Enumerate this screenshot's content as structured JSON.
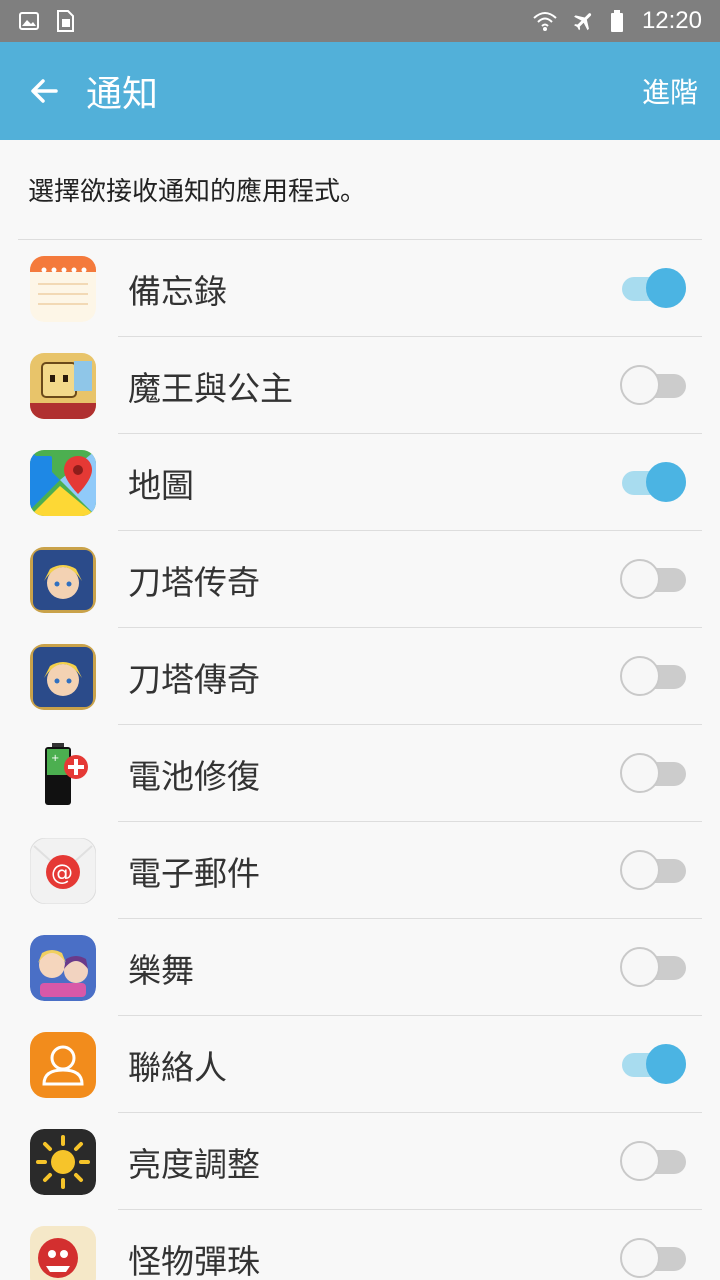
{
  "status_bar": {
    "time": "12:20",
    "icons": [
      "image-icon",
      "sim-icon",
      "wifi-icon",
      "airplane-icon",
      "battery-icon"
    ]
  },
  "app_bar": {
    "title": "通知",
    "advanced_label": "進階"
  },
  "description": "選擇欲接收通知的應用程式。",
  "apps": [
    {
      "name": "備忘錄",
      "enabled": true,
      "icon": "memo-icon"
    },
    {
      "name": "魔王與公主",
      "enabled": false,
      "icon": "game-icon"
    },
    {
      "name": "地圖",
      "enabled": true,
      "icon": "maps-icon"
    },
    {
      "name": "刀塔传奇",
      "enabled": false,
      "icon": "game-hero-icon"
    },
    {
      "name": "刀塔傳奇",
      "enabled": false,
      "icon": "game-hero-icon"
    },
    {
      "name": "電池修復",
      "enabled": false,
      "icon": "battery-repair-icon"
    },
    {
      "name": "電子郵件",
      "enabled": false,
      "icon": "email-icon"
    },
    {
      "name": "樂舞",
      "enabled": false,
      "icon": "dance-game-icon"
    },
    {
      "name": "聯絡人",
      "enabled": true,
      "icon": "contacts-icon"
    },
    {
      "name": "亮度調整",
      "enabled": false,
      "icon": "brightness-icon"
    },
    {
      "name": "怪物彈珠",
      "enabled": false,
      "icon": "monster-icon"
    }
  ],
  "colors": {
    "accent": "#52b0d9",
    "switch_on": "#4bb4e3"
  }
}
